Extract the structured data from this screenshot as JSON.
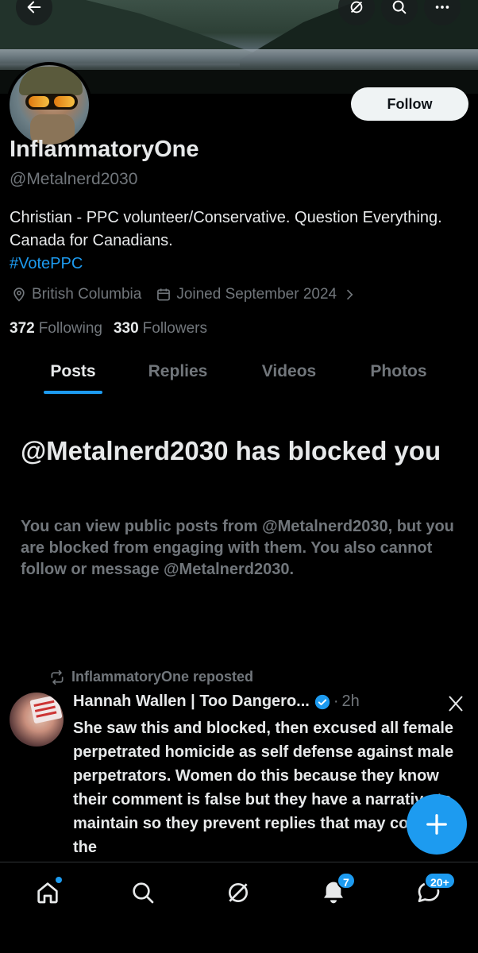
{
  "header": {
    "back_icon": "arrow-left-icon",
    "grok_icon": "grok-icon",
    "search_icon": "search-icon",
    "more_icon": "more-icon"
  },
  "profile": {
    "follow_label": "Follow",
    "display_name": "InflammatoryOne",
    "handle": "@Metalnerd2030",
    "bio": "Christian - PPC volunteer/Conservative. Question Everything. Canada for Canadians.",
    "bio_hashtag": "#VotePPC",
    "location": "British Columbia",
    "joined": "Joined September 2024",
    "following_count": "372",
    "following_label": "Following",
    "followers_count": "330",
    "followers_label": "Followers"
  },
  "tabs": [
    {
      "label": "Posts",
      "active": true
    },
    {
      "label": "Replies",
      "active": false
    },
    {
      "label": "Videos",
      "active": false
    },
    {
      "label": "Photos",
      "active": false
    }
  ],
  "blocked": {
    "title": "@Metalnerd2030 has blocked you",
    "text": "You can view public posts from @Metalnerd2030, but you are blocked from engaging with them. You also cannot follow or message @Metalnerd2030."
  },
  "post": {
    "repost_label": "InflammatoryOne reposted",
    "author": "Hannah Wallen | Too Dangero...",
    "time": "2h",
    "separator": "·",
    "text": "She saw this and blocked, then excused all female perpetrated homicide as self defense against male perpetrators. Women do this because they know their comment is false but they have a narrative to maintain so they prevent replies that may correct the"
  },
  "nav": {
    "notifications_badge": "7",
    "messages_badge": "20+"
  },
  "colors": {
    "accent": "#1d9bf0",
    "muted": "#71767b",
    "text": "#e7e9ea",
    "background": "#000000"
  }
}
